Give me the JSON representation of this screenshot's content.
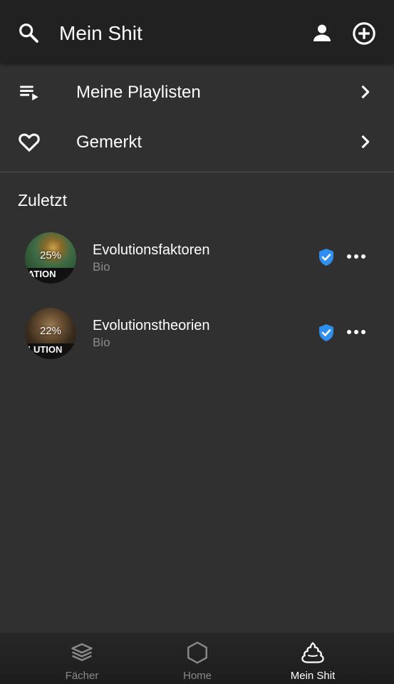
{
  "header": {
    "title": "Mein Shit"
  },
  "menu": [
    {
      "label": "Meine Playlisten",
      "icon": "playlist-icon"
    },
    {
      "label": "Gemerkt",
      "icon": "heart-icon"
    }
  ],
  "recent": {
    "title": "Zuletzt",
    "items": [
      {
        "name": "Evolutionsfaktoren",
        "subject": "Bio",
        "progress": "25%",
        "thumb_text": "ATION",
        "verified": true
      },
      {
        "name": "Evolutionstheorien",
        "subject": "Bio",
        "progress": "22%",
        "thumb_text": "LUTION",
        "verified": true
      }
    ]
  },
  "bottom_nav": [
    {
      "label": "Fächer",
      "icon": "stack-icon",
      "active": false
    },
    {
      "label": "Home",
      "icon": "hexagon-icon",
      "active": false
    },
    {
      "label": "Mein Shit",
      "icon": "poop-icon",
      "active": true
    }
  ],
  "colors": {
    "background": "#303030",
    "topbar": "#212121",
    "accent_blue": "#2f8ff0",
    "muted_text": "#8c8c8c"
  }
}
